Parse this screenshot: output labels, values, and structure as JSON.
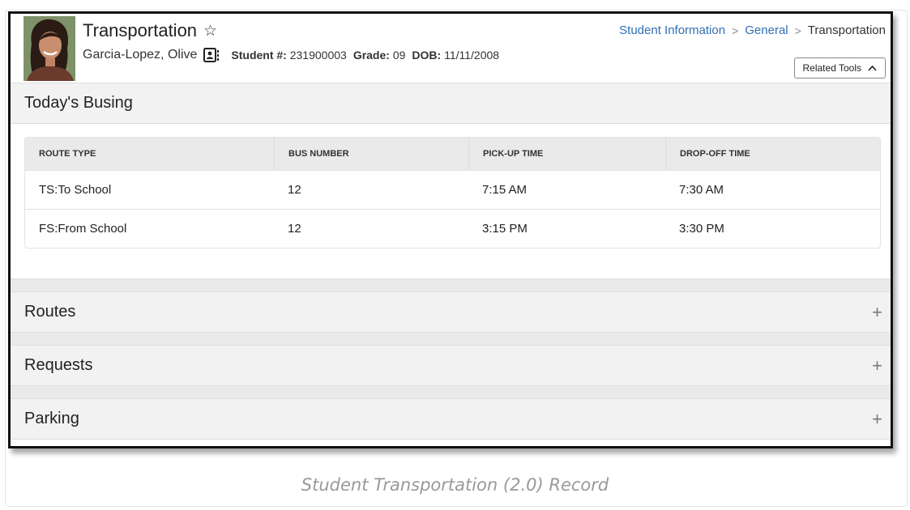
{
  "header": {
    "title": "Transportation",
    "student_name": "Garcia-Lopez, Olive",
    "student_number_label": "Student #:",
    "student_number": "231900003",
    "grade_label": "Grade:",
    "grade": "09",
    "dob_label": "DOB:",
    "dob": "11/11/2008",
    "related_tools_label": "Related Tools"
  },
  "breadcrumb": {
    "items": [
      "Student Information",
      "General"
    ],
    "current": "Transportation"
  },
  "todays_busing": {
    "title": "Today's Busing",
    "columns": [
      "ROUTE TYPE",
      "BUS NUMBER",
      "PICK-UP TIME",
      "DROP-OFF TIME"
    ],
    "rows": [
      [
        "TS:To School",
        "12",
        "7:15 AM",
        "7:30 AM"
      ],
      [
        "FS:From School",
        "12",
        "3:15 PM",
        "3:30 PM"
      ]
    ]
  },
  "sections": [
    {
      "title": "Routes"
    },
    {
      "title": "Requests"
    },
    {
      "title": "Parking"
    }
  ],
  "caption": "Student Transportation (2.0) Record",
  "colors": {
    "link": "#2f6fb5",
    "section_bg": "#f2f2f2",
    "table_header_bg": "#eaeaea"
  }
}
